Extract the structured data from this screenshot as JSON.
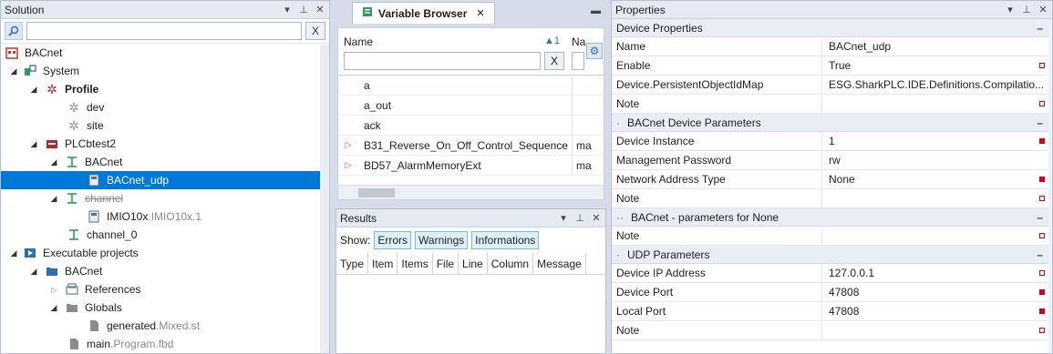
{
  "solution": {
    "title": "Solution",
    "search_value": "",
    "clear_label": "X",
    "nodes": [
      {
        "label": "BACnet",
        "suffix": ""
      },
      {
        "label": "System",
        "suffix": ""
      },
      {
        "label": "Profile",
        "suffix": ""
      },
      {
        "label": "dev",
        "suffix": ""
      },
      {
        "label": "site",
        "suffix": ""
      },
      {
        "label": "PLCbtest2",
        "suffix": ""
      },
      {
        "label": "BACnet",
        "suffix": ""
      },
      {
        "label": "BACnet_udp",
        "suffix": ""
      },
      {
        "label": "channel",
        "suffix": ""
      },
      {
        "label": "IMIO10x",
        "suffix": ".IMIO10x.1"
      },
      {
        "label": "channel_0",
        "suffix": ""
      },
      {
        "label": "Executable projects",
        "suffix": ""
      },
      {
        "label": "BACnet",
        "suffix": ""
      },
      {
        "label": "References",
        "suffix": ""
      },
      {
        "label": "Globals",
        "suffix": ""
      },
      {
        "label": "generated",
        "suffix": ".Mixed.st"
      },
      {
        "label": "main",
        "suffix": ".Program.fbd"
      }
    ]
  },
  "variable_browser": {
    "tab_label": "Variable Browser",
    "col_name": "Name",
    "sort_indicator": "▲1",
    "col_type": "Na",
    "clear_label": "X",
    "rows": [
      {
        "name": "a",
        "type": "",
        "expandable": false
      },
      {
        "name": "a_out",
        "type": "",
        "expandable": false
      },
      {
        "name": "ack",
        "type": "",
        "expandable": false
      },
      {
        "name": "B31_Reverse_On_Off_Control_Sequence",
        "type": "ma",
        "expandable": true
      },
      {
        "name": "BD57_AlarmMemoryExt",
        "type": "ma",
        "expandable": true
      }
    ]
  },
  "results": {
    "title": "Results",
    "show_label": "Show:",
    "filters": [
      "Errors",
      "Warnings",
      "Informations"
    ],
    "columns": [
      "Type",
      "Item",
      "Items",
      "File",
      "Line",
      "Column",
      "Message"
    ]
  },
  "properties": {
    "title": "Properties",
    "sections": [
      {
        "label": "Device Properties",
        "rows": [
          {
            "key": "Name",
            "value": "BACnet_udp",
            "marker": "none"
          },
          {
            "key": "Enable",
            "value": "True",
            "marker": "hollow"
          },
          {
            "key": "Device.PersistentObjectIdMap",
            "value": "ESG.SharkPLC.IDE.Definitions.Compilatio...",
            "marker": "none"
          },
          {
            "key": "Note",
            "value": "",
            "marker": "hollow"
          }
        ]
      },
      {
        "label": "BACnet Device Parameters",
        "rows": [
          {
            "key": "Device Instance",
            "value": "1",
            "marker": "filled"
          },
          {
            "key": "Management Password",
            "value": "rw",
            "marker": "none"
          },
          {
            "key": "Network Address Type",
            "value": "None",
            "marker": "filled"
          },
          {
            "key": "Note",
            "value": "",
            "marker": "hollow"
          }
        ]
      },
      {
        "label": "BACnet - parameters for None",
        "rows": [
          {
            "key": "Note",
            "value": "",
            "marker": "hollow"
          }
        ]
      },
      {
        "label": "UDP Parameters",
        "rows": [
          {
            "key": "Device IP Address",
            "value": "127.0.0.1",
            "marker": "hollow"
          },
          {
            "key": "Device Port",
            "value": "47808",
            "marker": "filled"
          },
          {
            "key": "Local Port",
            "value": "47808",
            "marker": "filled"
          },
          {
            "key": "Note",
            "value": "",
            "marker": "hollow"
          }
        ]
      }
    ]
  }
}
